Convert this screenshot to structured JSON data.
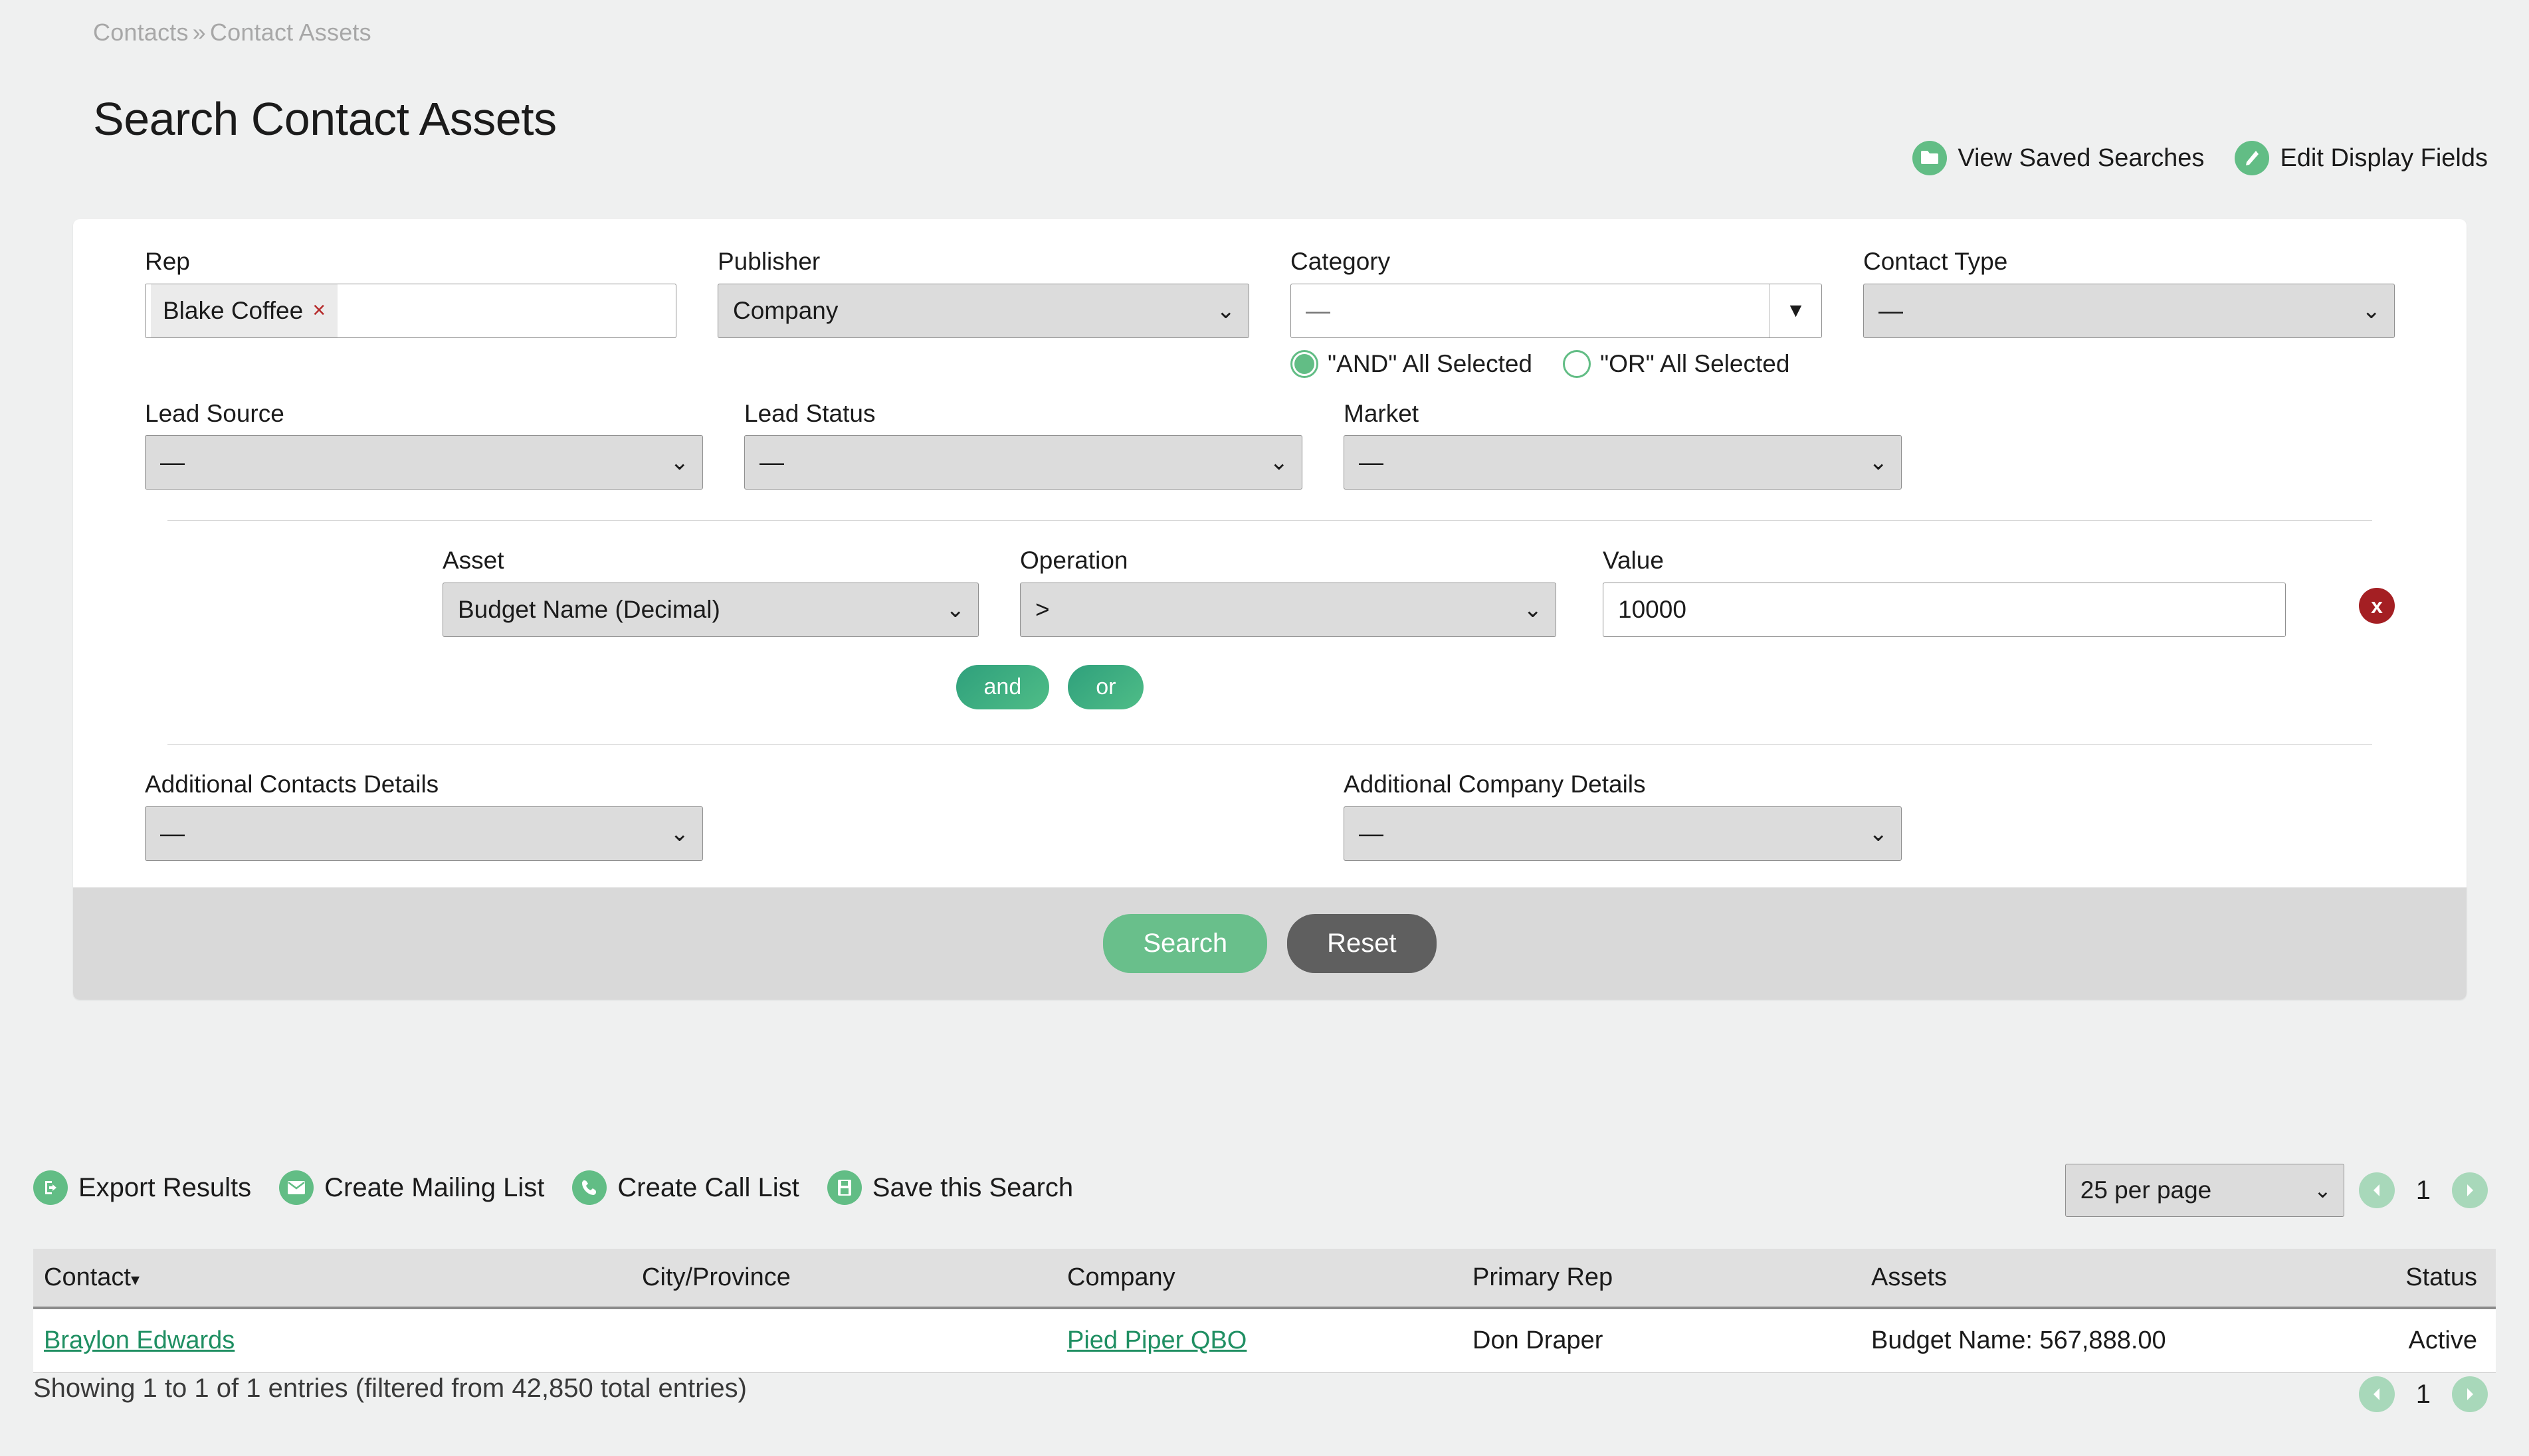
{
  "breadcrumb": {
    "parent": "Contacts",
    "separator": "»",
    "current": "Contact Assets"
  },
  "page_title": "Search Contact Assets",
  "top_actions": [
    {
      "label": "View Saved Searches",
      "icon": "folder-icon"
    },
    {
      "label": "Edit Display Fields",
      "icon": "pencil-icon"
    }
  ],
  "search_form": {
    "rep": {
      "label": "Rep",
      "tokens": [
        {
          "text": "Blake Coffee",
          "remove": "×"
        }
      ]
    },
    "publisher": {
      "label": "Publisher",
      "value": "Company"
    },
    "category": {
      "label": "Category",
      "value": "—",
      "arrow": "▼",
      "radios": [
        {
          "label": "\"AND\" All Selected",
          "selected": true
        },
        {
          "label": "\"OR\" All Selected",
          "selected": false
        }
      ]
    },
    "contact_type": {
      "label": "Contact Type",
      "value": "—"
    },
    "lead_source": {
      "label": "Lead Source",
      "value": "—"
    },
    "lead_status": {
      "label": "Lead Status",
      "value": "—"
    },
    "market": {
      "label": "Market",
      "value": "—"
    },
    "criteria": {
      "asset": {
        "label": "Asset",
        "value": "Budget Name (Decimal)"
      },
      "operation": {
        "label": "Operation",
        "value": ">"
      },
      "value": {
        "label": "Value",
        "value": "10000"
      },
      "delete_label": "x",
      "pills": [
        {
          "label": "and"
        },
        {
          "label": "or"
        }
      ]
    },
    "additional_contacts": {
      "label": "Additional Contacts Details",
      "value": "—"
    },
    "additional_company": {
      "label": "Additional Company Details",
      "value": "—"
    },
    "buttons": {
      "search": "Search",
      "reset": "Reset"
    }
  },
  "results_actions": [
    {
      "label": "Export Results",
      "icon": "export-icon"
    },
    {
      "label": "Create Mailing List",
      "icon": "envelope-icon"
    },
    {
      "label": "Create Call List",
      "icon": "phone-icon"
    },
    {
      "label": "Save this Search",
      "icon": "save-icon"
    }
  ],
  "pagination": {
    "per_page": "25 per page",
    "prev": "◀",
    "next": "▶",
    "current_page": "1"
  },
  "table": {
    "columns": [
      "Contact",
      "City/Province",
      "Company",
      "Primary Rep",
      "Assets",
      "Status"
    ],
    "sort_caret": "▾",
    "rows": [
      {
        "contact": "Braylon Edwards",
        "city_province": "",
        "company": "Pied Piper QBO",
        "primary_rep": "Don Draper",
        "assets": "Budget Name: 567,888.00",
        "status": "Active"
      }
    ]
  },
  "footer": {
    "showing": "Showing 1 to 1 of 1 entries (filtered from 42,850 total entries)"
  },
  "colors": {
    "accent_green": "#62bd85",
    "link_green": "#1f8f62",
    "danger_red": "#a41f23",
    "page_bg": "#eff0f0"
  }
}
